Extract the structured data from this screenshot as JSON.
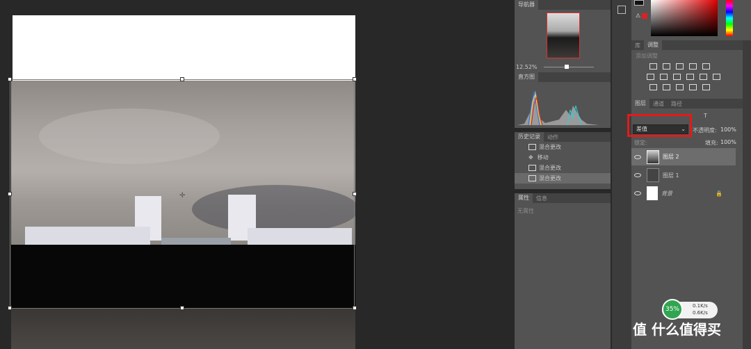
{
  "navigator": {
    "title": "导航器",
    "zoom": "12.52%"
  },
  "histogram": {
    "title": "直方图"
  },
  "history": {
    "tabs": [
      "历史记录",
      "动作"
    ],
    "items": [
      "混合更改",
      "移动",
      "混合更改",
      "混合更改"
    ]
  },
  "properties": {
    "tabs": [
      "属性",
      "信息"
    ],
    "empty": "无属性"
  },
  "library": {
    "tabs": [
      "库",
      "调整"
    ],
    "add_label": "添加调整"
  },
  "layers": {
    "tabs": [
      "图层",
      "通道",
      "路径"
    ],
    "blend_mode": "差值",
    "opacity_label": "不透明度:",
    "opacity": "100%",
    "lock_label": "锁定:",
    "fill_label": "填充:",
    "fill": "100%",
    "items": [
      {
        "name": "图层 2"
      },
      {
        "name": "图层 1"
      },
      {
        "name": "背景"
      }
    ]
  },
  "netspeed": {
    "percent": "35%",
    "up": "0.1K/s",
    "down": "0.6K/s"
  },
  "watermark": {
    "text": "值 什么值得买"
  }
}
